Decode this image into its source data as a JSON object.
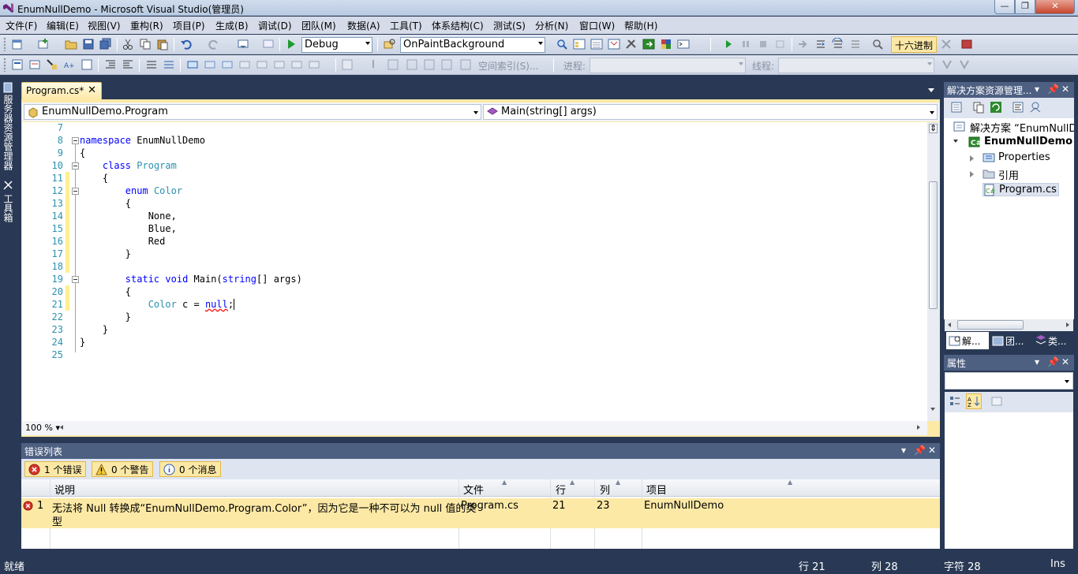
{
  "window": {
    "title": "EnumNullDemo - Microsoft Visual Studio(管理员)",
    "min": "—",
    "max": "❐",
    "close": "✕"
  },
  "menu": [
    "文件(F)",
    "编辑(E)",
    "视图(V)",
    "重构(R)",
    "项目(P)",
    "生成(B)",
    "调试(D)",
    "团队(M)",
    "数据(A)",
    "工具(T)",
    "体系结构(C)",
    "测试(S)",
    "分析(N)",
    "窗口(W)",
    "帮助(H)"
  ],
  "toolbar": {
    "config": "Debug",
    "find_combo": "OnPaintBackground",
    "hex_button": "十六进制",
    "space_index": "空间索引(S)...",
    "process_label": "进程:",
    "thread_label": "线程:"
  },
  "side_tabs": [
    "服务器资源管理器",
    "工具箱"
  ],
  "document": {
    "tab_label": "Program.cs*",
    "tab_close": "✕",
    "nav_class": "EnumNullDemo.Program",
    "nav_member": "Main(string[] args)",
    "zoom": "100 %"
  },
  "code": {
    "lines": [
      {
        "n": "7",
        "text": ""
      },
      {
        "n": "8",
        "text": "namespace EnumNullDemo"
      },
      {
        "n": "9",
        "text": "{"
      },
      {
        "n": "10",
        "text": "    class Program"
      },
      {
        "n": "11",
        "text": "    {"
      },
      {
        "n": "12",
        "text": "        enum Color"
      },
      {
        "n": "13",
        "text": "        {"
      },
      {
        "n": "14",
        "text": "            None,"
      },
      {
        "n": "15",
        "text": "            Blue,"
      },
      {
        "n": "16",
        "text": "            Red"
      },
      {
        "n": "17",
        "text": "        }"
      },
      {
        "n": "18",
        "text": ""
      },
      {
        "n": "19",
        "text": "        static void Main(string[] args)"
      },
      {
        "n": "20",
        "text": "        {"
      },
      {
        "n": "21",
        "text": "            Color c = null;"
      },
      {
        "n": "22",
        "text": "        }"
      },
      {
        "n": "23",
        "text": "    }"
      },
      {
        "n": "24",
        "text": "}"
      },
      {
        "n": "25",
        "text": ""
      }
    ]
  },
  "error_list": {
    "title": "错误列表",
    "errors_btn": "1 个错误",
    "warnings_btn": "0 个警告",
    "messages_btn": "0 个消息",
    "columns": {
      "desc": "说明",
      "file": "文件",
      "line": "行",
      "col": "列",
      "project": "项目"
    },
    "rows": [
      {
        "index": "1",
        "desc_line1": "无法将 Null 转换成“EnumNullDemo.Program.Color”，因为它是一种不可以为 null 值的类",
        "desc_line2": "型",
        "file": "Program.cs",
        "line": "21",
        "col": "23",
        "project": "EnumNullDemo"
      }
    ]
  },
  "solution_explorer": {
    "title": "解决方案资源管理...",
    "solution": "解决方案 “EnumNullDemo”",
    "project": "EnumNullDemo",
    "items": [
      "Properties",
      "引用",
      "Program.cs"
    ],
    "tabs": [
      "解...",
      "团...",
      "类..."
    ]
  },
  "properties": {
    "title": "属性"
  },
  "status": {
    "ready": "就绪",
    "line": "行 21",
    "col": "列 28",
    "char": "字符 28",
    "ins": "Ins"
  },
  "colors": {
    "chrome": "#293955",
    "accent_tab": "#fde9a6",
    "keyword": "#0000ff",
    "type": "#2b91af",
    "error": "#d9362c"
  }
}
